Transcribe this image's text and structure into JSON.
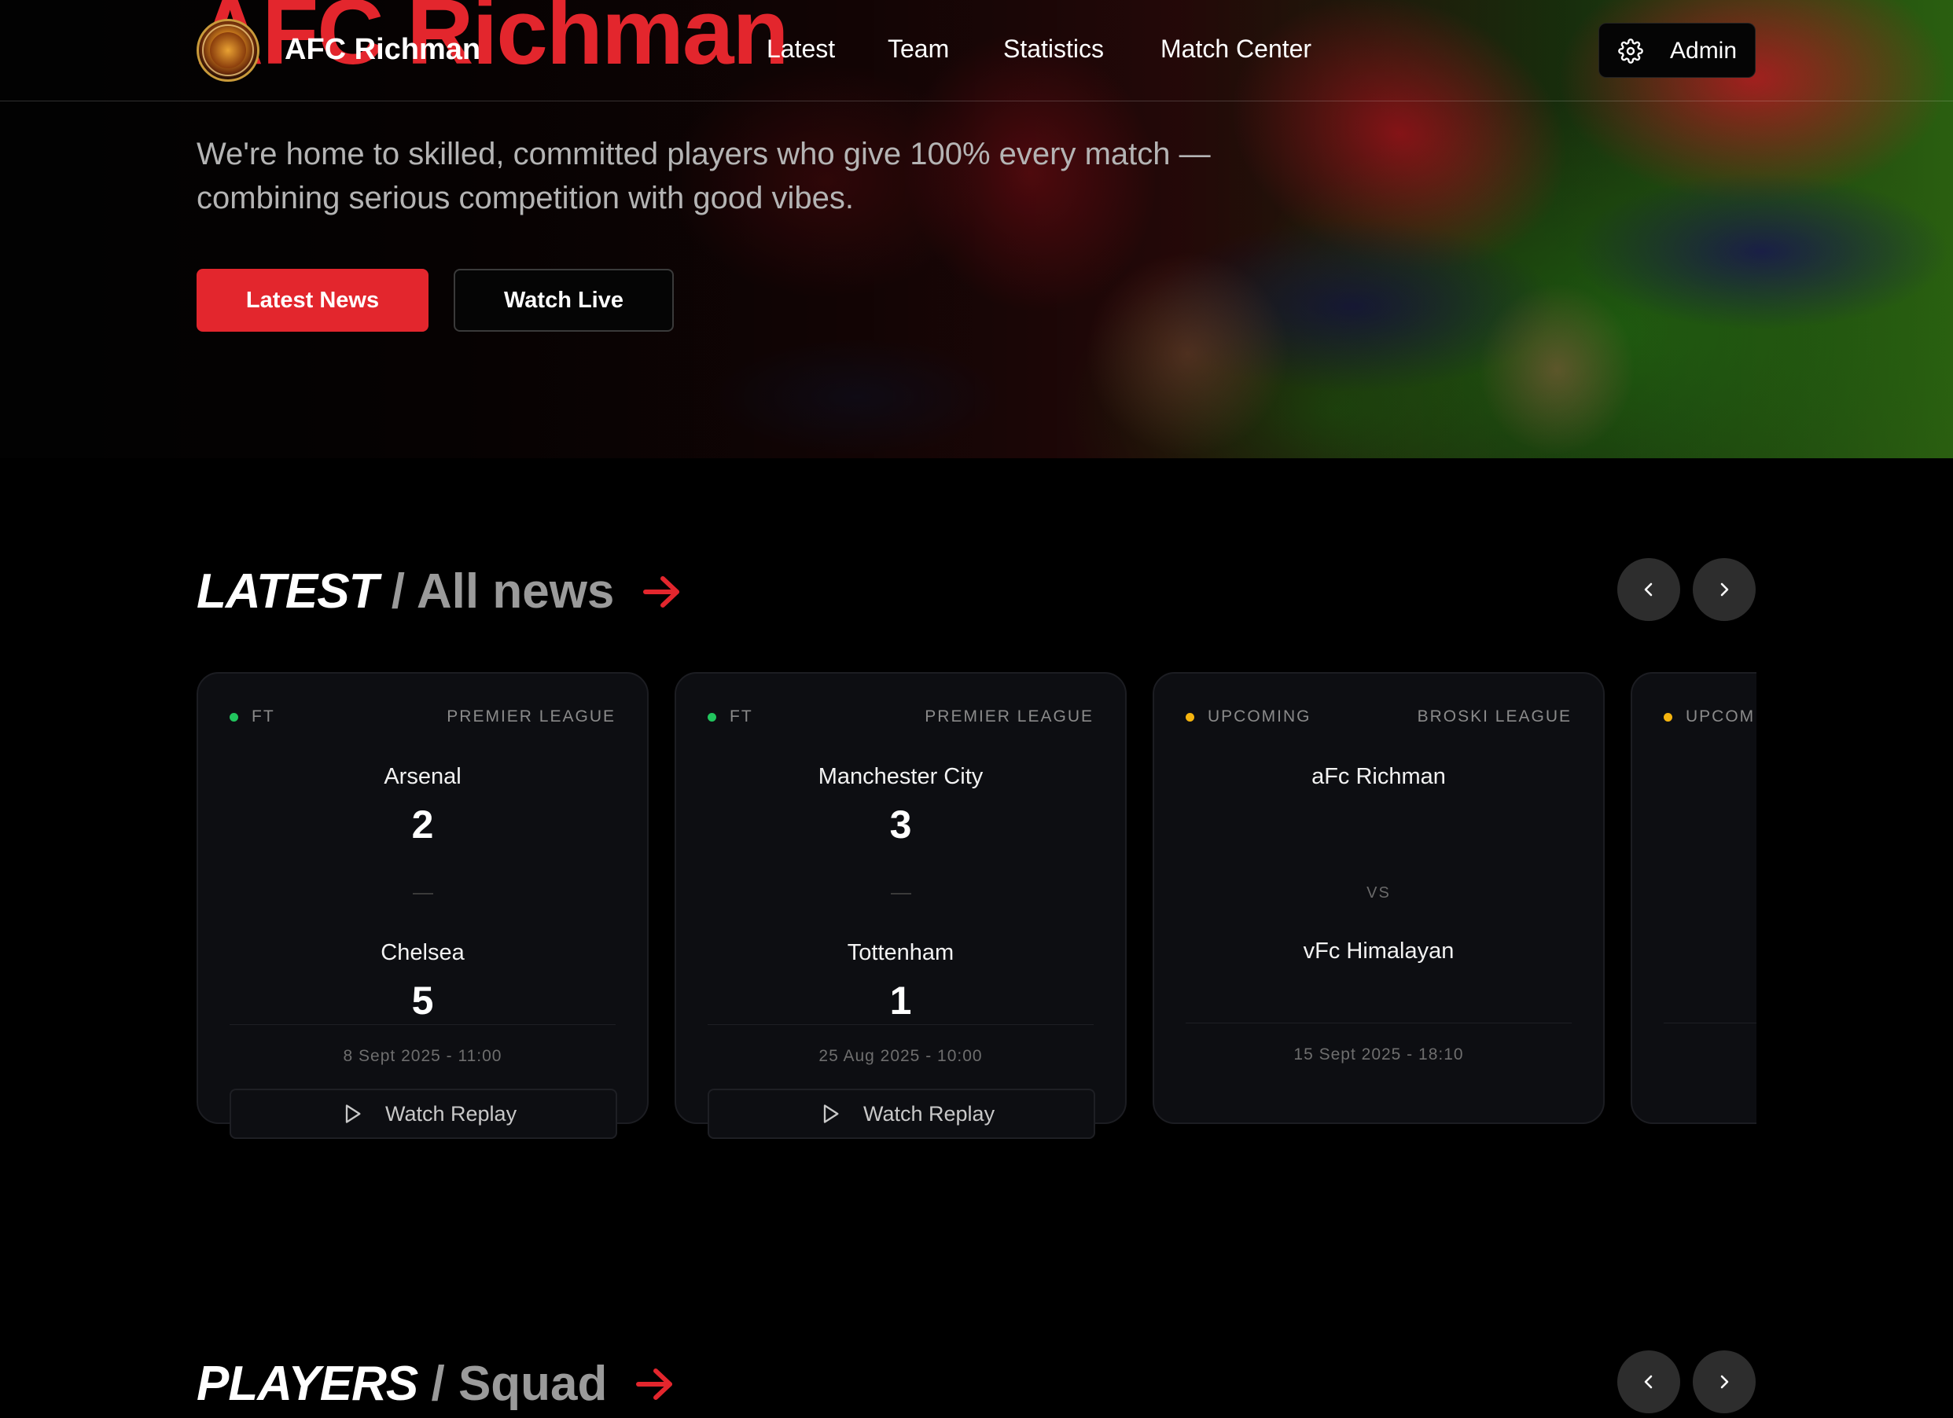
{
  "brand": {
    "hero_title": "AFC Richman",
    "name": "AFC Richman",
    "accent_color": "#e3262d"
  },
  "nav": {
    "links": [
      "Latest",
      "Team",
      "Statistics",
      "Match Center"
    ],
    "admin_label": "Admin",
    "admin_icon": "gear-icon"
  },
  "hero": {
    "subtitle": "We're home to skilled, committed players who give 100% every match — combining serious competition with good vibes.",
    "primary_button": "Latest News",
    "secondary_button": "Watch Live"
  },
  "latest": {
    "title": "LATEST",
    "separator": "/",
    "subtitle": "All news",
    "cards": [
      {
        "status": "FT",
        "status_color": "#22c55e",
        "league": "PREMIER LEAGUE",
        "home_team": "Arsenal",
        "home_score": "2",
        "away_team": "Chelsea",
        "away_score": "5",
        "date": "8 Sept 2025 - 11:00",
        "action": "Watch Replay"
      },
      {
        "status": "FT",
        "status_color": "#22c55e",
        "league": "PREMIER LEAGUE",
        "home_team": "Manchester City",
        "home_score": "3",
        "away_team": "Tottenham",
        "away_score": "1",
        "date": "25 Aug 2025 - 10:00",
        "action": "Watch Replay"
      },
      {
        "status": "UPCOMING",
        "status_color": "#f5b40f",
        "league": "BROSKI LEAGUE",
        "home_team": "aFc Richman",
        "vs": "VS",
        "away_team": "vFc Himalayan",
        "date": "15 Sept 2025 - 18:10"
      },
      {
        "status": "UPCOMING",
        "status_color": "#f5b40f"
      }
    ]
  },
  "players": {
    "title": "PLAYERS",
    "separator": "/",
    "subtitle": "Squad"
  }
}
